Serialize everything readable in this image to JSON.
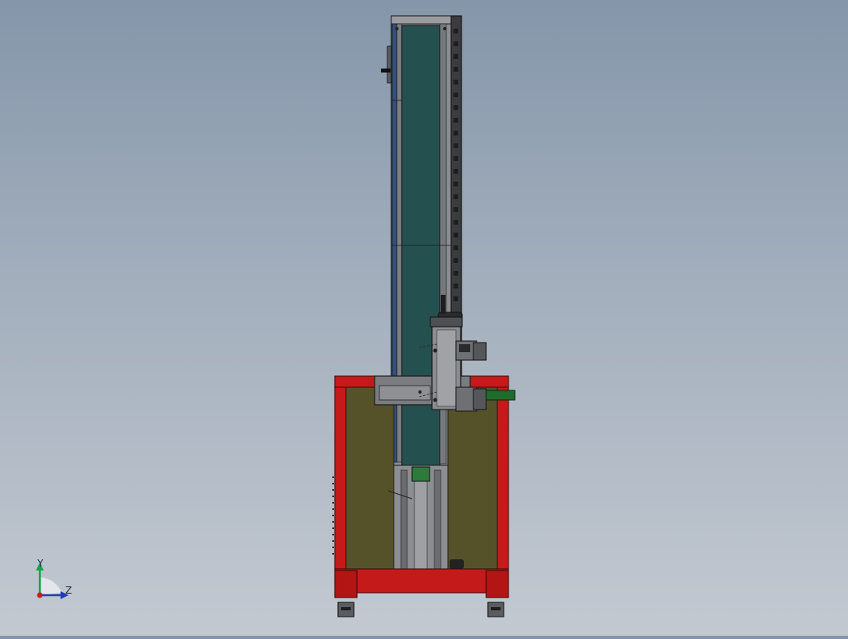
{
  "triad": {
    "y_label": "Y",
    "z_label": "Z"
  },
  "colors": {
    "background_top": "#8596aa",
    "background_bottom": "#c3c9d1",
    "frame_red": "#c41a1a",
    "panel_olive": "#55522a",
    "conveyor_teal": "#255050",
    "metal_gray": "#7d7f83",
    "accent_green": "#1e6a2a"
  }
}
